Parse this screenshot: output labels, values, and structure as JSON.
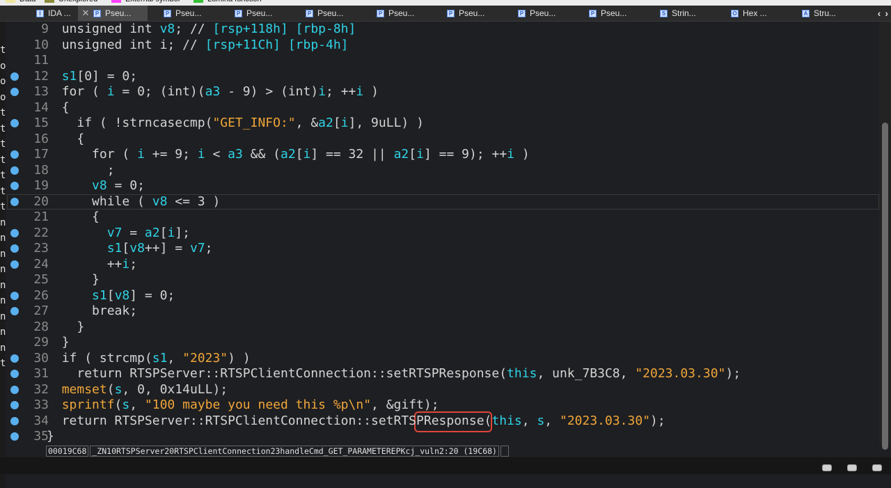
{
  "legend": [
    {
      "label": "Data",
      "color": "#f0e6a0"
    },
    {
      "label": "Unexplored",
      "color": "#8b8b3a"
    },
    {
      "label": "External symbol",
      "color": "#ff40ff"
    },
    {
      "label": "Lumina function",
      "color": "#35c035"
    }
  ],
  "tabs": [
    {
      "label": "IDA ...",
      "icon": "ida-view-icon",
      "closable": false,
      "active": false
    },
    {
      "label": "Pseu...",
      "icon": "pseudocode-icon",
      "closable": true,
      "active": true
    },
    {
      "label": "Pseu...",
      "icon": "pseudocode-icon",
      "closable": false,
      "active": false
    },
    {
      "label": "Pseu...",
      "icon": "pseudocode-icon",
      "closable": false,
      "active": false
    },
    {
      "label": "Pseu...",
      "icon": "pseudocode-icon",
      "closable": false,
      "active": false
    },
    {
      "label": "Pseu...",
      "icon": "pseudocode-icon",
      "closable": false,
      "active": false
    },
    {
      "label": "Pseu...",
      "icon": "pseudocode-icon",
      "closable": false,
      "active": false
    },
    {
      "label": "Pseu...",
      "icon": "pseudocode-icon",
      "closable": false,
      "active": false
    },
    {
      "label": "Pseu...",
      "icon": "pseudocode-icon",
      "closable": false,
      "active": false
    },
    {
      "label": "Strin...",
      "icon": "strings-icon",
      "closable": false,
      "active": false
    },
    {
      "label": "Hex ...",
      "icon": "hex-view-icon",
      "closable": false,
      "active": false
    },
    {
      "label": "Stru...",
      "icon": "structures-icon",
      "closable": false,
      "active": false
    }
  ],
  "left_pane_chars": [
    "t",
    "o",
    "o",
    "o",
    "t",
    "t",
    "t",
    "t",
    "t",
    "t",
    "t",
    "n",
    "n",
    "n",
    "n",
    "n",
    "n",
    "n",
    "n",
    "n",
    "t"
  ],
  "code_lines": [
    {
      "n": "9",
      "bp": false,
      "indent": 1,
      "tokens": [
        [
          "kw",
          "unsigned int "
        ],
        [
          "v",
          "v8"
        ],
        [
          "kw",
          "; // "
        ],
        [
          "v",
          "[rsp+118h] [rbp-8h]"
        ]
      ]
    },
    {
      "n": "10",
      "bp": false,
      "indent": 1,
      "tokens": [
        [
          "kw",
          "unsigned int "
        ],
        [
          "kw",
          "i"
        ],
        [
          "kw",
          "; // "
        ],
        [
          "v",
          "[rsp+11Ch] [rbp-4h]"
        ]
      ]
    },
    {
      "n": "11",
      "bp": false,
      "indent": 0,
      "tokens": []
    },
    {
      "n": "12",
      "bp": true,
      "indent": 1,
      "tokens": [
        [
          "v",
          "s1"
        ],
        [
          "kw",
          "[0] = 0;"
        ]
      ]
    },
    {
      "n": "13",
      "bp": true,
      "indent": 1,
      "tokens": [
        [
          "kw",
          "for ( "
        ],
        [
          "v",
          "i"
        ],
        [
          "kw",
          " = 0; (int)("
        ],
        [
          "v",
          "a3"
        ],
        [
          "kw",
          " - 9) > (int)"
        ],
        [
          "v",
          "i"
        ],
        [
          "kw",
          "; ++"
        ],
        [
          "v",
          "i"
        ],
        [
          "kw",
          " )"
        ]
      ]
    },
    {
      "n": "14",
      "bp": false,
      "indent": 1,
      "tokens": [
        [
          "kw",
          "{"
        ]
      ]
    },
    {
      "n": "15",
      "bp": true,
      "indent": 2,
      "tokens": [
        [
          "kw",
          "if ( !strncasecmp("
        ],
        [
          "s",
          "\"GET_INFO:\""
        ],
        [
          "kw",
          ", &"
        ],
        [
          "v",
          "a2"
        ],
        [
          "kw",
          "["
        ],
        [
          "v",
          "i"
        ],
        [
          "kw",
          "], 9uLL) )"
        ]
      ]
    },
    {
      "n": "16",
      "bp": false,
      "indent": 2,
      "tokens": [
        [
          "kw",
          "{"
        ]
      ]
    },
    {
      "n": "17",
      "bp": true,
      "indent": 3,
      "tokens": [
        [
          "kw",
          "for ( "
        ],
        [
          "v",
          "i"
        ],
        [
          "kw",
          " += 9; "
        ],
        [
          "v",
          "i"
        ],
        [
          "kw",
          " < "
        ],
        [
          "v",
          "a3"
        ],
        [
          "kw",
          " && ("
        ],
        [
          "v",
          "a2"
        ],
        [
          "kw",
          "["
        ],
        [
          "v",
          "i"
        ],
        [
          "kw",
          "] == 32 || "
        ],
        [
          "v",
          "a2"
        ],
        [
          "kw",
          "["
        ],
        [
          "v",
          "i"
        ],
        [
          "kw",
          "] == 9); ++"
        ],
        [
          "v",
          "i"
        ],
        [
          "kw",
          " )"
        ]
      ]
    },
    {
      "n": "18",
      "bp": true,
      "indent": 4,
      "tokens": [
        [
          "kw",
          ";"
        ]
      ]
    },
    {
      "n": "19",
      "bp": true,
      "indent": 3,
      "tokens": [
        [
          "v",
          "v8"
        ],
        [
          "kw",
          " = 0;"
        ]
      ]
    },
    {
      "n": "20",
      "bp": true,
      "indent": 3,
      "tokens": [
        [
          "kw",
          "while ( "
        ],
        [
          "v",
          "v8"
        ],
        [
          "kw",
          " <= 3 )"
        ]
      ],
      "current": true
    },
    {
      "n": "21",
      "bp": false,
      "indent": 3,
      "tokens": [
        [
          "kw",
          "{"
        ]
      ]
    },
    {
      "n": "22",
      "bp": true,
      "indent": 4,
      "tokens": [
        [
          "v",
          "v7"
        ],
        [
          "kw",
          " = "
        ],
        [
          "v",
          "a2"
        ],
        [
          "kw",
          "["
        ],
        [
          "v",
          "i"
        ],
        [
          "kw",
          "];"
        ]
      ]
    },
    {
      "n": "23",
      "bp": true,
      "indent": 4,
      "tokens": [
        [
          "v",
          "s1"
        ],
        [
          "kw",
          "["
        ],
        [
          "v",
          "v8"
        ],
        [
          "kw",
          "++] = "
        ],
        [
          "v",
          "v7"
        ],
        [
          "kw",
          ";"
        ]
      ]
    },
    {
      "n": "24",
      "bp": true,
      "indent": 4,
      "tokens": [
        [
          "kw",
          "++"
        ],
        [
          "v",
          "i"
        ],
        [
          "kw",
          ";"
        ]
      ]
    },
    {
      "n": "25",
      "bp": false,
      "indent": 3,
      "tokens": [
        [
          "kw",
          "}"
        ]
      ]
    },
    {
      "n": "26",
      "bp": true,
      "indent": 3,
      "tokens": [
        [
          "v",
          "s1"
        ],
        [
          "kw",
          "["
        ],
        [
          "v",
          "v8"
        ],
        [
          "kw",
          "] = 0;"
        ]
      ]
    },
    {
      "n": "27",
      "bp": true,
      "indent": 3,
      "tokens": [
        [
          "kw",
          "break;"
        ]
      ]
    },
    {
      "n": "28",
      "bp": false,
      "indent": 2,
      "tokens": [
        [
          "kw",
          "}"
        ]
      ]
    },
    {
      "n": "29",
      "bp": false,
      "indent": 1,
      "tokens": [
        [
          "kw",
          "}"
        ]
      ]
    },
    {
      "n": "30",
      "bp": true,
      "indent": 1,
      "tokens": [
        [
          "kw",
          "if ( strcmp("
        ],
        [
          "v",
          "s1"
        ],
        [
          "kw",
          ", "
        ],
        [
          "s",
          "\"2023\""
        ],
        [
          "kw",
          ") )"
        ]
      ]
    },
    {
      "n": "31",
      "bp": true,
      "indent": 2,
      "tokens": [
        [
          "kw",
          "return RTSPServer::RTSPClientConnection::setRTSPResponse("
        ],
        [
          "v",
          "this"
        ],
        [
          "kw",
          ", unk_7B3C8, "
        ],
        [
          "s",
          "\"2023.03.30\""
        ],
        [
          "kw",
          ");"
        ]
      ]
    },
    {
      "n": "32",
      "bp": true,
      "indent": 1,
      "tokens": [
        [
          "s",
          "memset"
        ],
        [
          "kw",
          "("
        ],
        [
          "v",
          "s"
        ],
        [
          "kw",
          ", 0, 0x14uLL);"
        ]
      ]
    },
    {
      "n": "33",
      "bp": true,
      "indent": 1,
      "tokens": [
        [
          "s",
          "sprintf"
        ],
        [
          "kw",
          "("
        ],
        [
          "v",
          "s"
        ],
        [
          "kw",
          ", "
        ],
        [
          "s",
          "\"100 maybe you need this %p\\n\""
        ],
        [
          "kw",
          ", &gift);"
        ]
      ]
    },
    {
      "n": "34",
      "bp": true,
      "indent": 1,
      "tokens": [
        [
          "kw",
          "return RTSPServer::RTSPClientConnection::setRTSPResponse("
        ],
        [
          "v",
          "this"
        ],
        [
          "kw",
          ", "
        ],
        [
          "v",
          "s"
        ],
        [
          "kw",
          ", "
        ],
        [
          "s",
          "\"2023.03.30\""
        ],
        [
          "kw",
          ");"
        ]
      ]
    },
    {
      "n": "35",
      "bp": true,
      "indent": 0,
      "tokens": [
        [
          "kw",
          "}"
        ]
      ]
    }
  ],
  "status": {
    "address": "00019C68",
    "location": "_ZN10RTSPServer20RTSPClientConnection23handleCmd_GET_PARAMETEREPKcj_vuln2:20 (19C68)"
  }
}
